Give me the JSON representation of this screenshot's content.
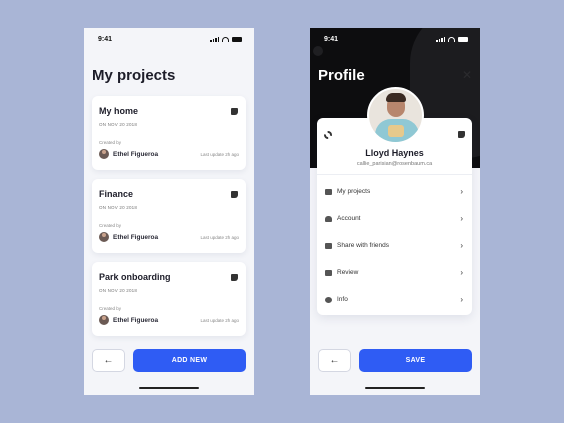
{
  "projects_screen": {
    "time": "9:41",
    "title": "My projects",
    "cards": [
      {
        "name": "My home",
        "date": "ON NOV 20 2018",
        "created_label": "Created by",
        "owner": "Ethel Figueroa",
        "updated": "Last update 2h ago"
      },
      {
        "name": "Finance",
        "date": "ON NOV 20 2018",
        "created_label": "Created by",
        "owner": "Ethel Figueroa",
        "updated": "Last update 2h ago"
      },
      {
        "name": "Park onboarding",
        "date": "ON NOV 20 2018",
        "created_label": "Created by",
        "owner": "Ethel Figueroa",
        "updated": "Last update 2h ago"
      }
    ],
    "back_label": "←",
    "primary_label": "ADD NEW"
  },
  "profile_screen": {
    "time": "9:41",
    "title": "Profile",
    "name": "Lloyd Haynes",
    "email": "callie_parisian@rosenbaum.ca",
    "menu": [
      {
        "label": "My projects",
        "icon": "folder-icon"
      },
      {
        "label": "Account",
        "icon": "user-icon"
      },
      {
        "label": "Share with friends",
        "icon": "megaphone-icon"
      },
      {
        "label": "Review",
        "icon": "thumbs-up-icon"
      },
      {
        "label": "Info",
        "icon": "info-icon"
      }
    ],
    "back_label": "←",
    "primary_label": "SAVE"
  },
  "colors": {
    "background": "#a9b5d6",
    "accent": "#2f5cf4",
    "header": "#0d0d0f"
  }
}
